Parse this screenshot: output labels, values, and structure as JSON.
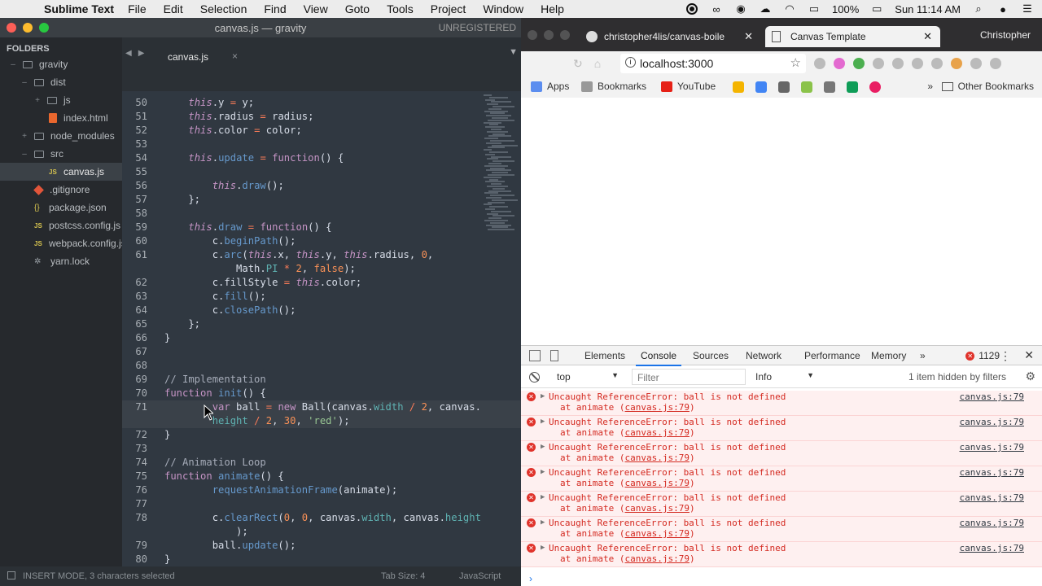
{
  "menubar": {
    "app_name": "Sublime Text",
    "items": [
      "File",
      "Edit",
      "Selection",
      "Find",
      "View",
      "Goto",
      "Tools",
      "Project",
      "Window",
      "Help"
    ],
    "battery": "100%",
    "clock": "Sun 11:14 AM"
  },
  "sublime": {
    "window_title": "canvas.js — gravity",
    "unregistered": "UNREGISTERED",
    "sidebar_header": "FOLDERS",
    "tree": [
      {
        "label": "gravity",
        "kind": "folder-open",
        "depth": 0
      },
      {
        "label": "dist",
        "kind": "folder-open",
        "depth": 1
      },
      {
        "label": "js",
        "kind": "folder-closed",
        "depth": 2
      },
      {
        "label": "index.html",
        "kind": "html",
        "depth": 2
      },
      {
        "label": "node_modules",
        "kind": "folder-closed",
        "depth": 1
      },
      {
        "label": "src",
        "kind": "folder-open",
        "depth": 1
      },
      {
        "label": "canvas.js",
        "kind": "js",
        "depth": 2,
        "selected": true
      },
      {
        "label": ".gitignore",
        "kind": "git",
        "depth": 1
      },
      {
        "label": "package.json",
        "kind": "json",
        "depth": 1
      },
      {
        "label": "postcss.config.js",
        "kind": "js",
        "depth": 1
      },
      {
        "label": "webpack.config.js",
        "kind": "js",
        "depth": 1
      },
      {
        "label": "yarn.lock",
        "kind": "dot",
        "depth": 1
      }
    ],
    "tab_label": "canvas.js",
    "status_mode": "INSERT MODE, 3 characters selected",
    "status_tabsize": "Tab Size: 4",
    "status_lang": "JavaScript",
    "code_lines": [
      {
        "n": "50",
        "html": "<span class=\"k\">this</span>.y <span class=\"op\">=</span> y;"
      },
      {
        "n": "51",
        "html": "<span class=\"k\">this</span>.radius <span class=\"op\">=</span> radius;"
      },
      {
        "n": "52",
        "html": "<span class=\"k\">this</span>.color <span class=\"op\">=</span> color;"
      },
      {
        "n": "53",
        "html": ""
      },
      {
        "n": "54",
        "html": "<span class=\"k\">this</span>.<span class=\"f\">update</span> <span class=\"op\">=</span> <span class=\"kw\">function</span>() {"
      },
      {
        "n": "55",
        "html": ""
      },
      {
        "n": "56",
        "html": "    <span class=\"k\">this</span>.<span class=\"f\">draw</span>();"
      },
      {
        "n": "57",
        "html": "};"
      },
      {
        "n": "58",
        "html": ""
      },
      {
        "n": "59",
        "html": "<span class=\"k\">this</span>.<span class=\"f\">draw</span> <span class=\"op\">=</span> <span class=\"kw\">function</span>() {"
      },
      {
        "n": "60",
        "html": "    c.<span class=\"f\">beginPath</span>();"
      },
      {
        "n": "61",
        "html": "    c.<span class=\"f\">arc</span>(<span class=\"k\">this</span>.x, <span class=\"k\">this</span>.y, <span class=\"k\">this</span>.radius, <span class=\"n\">0</span>,"
      },
      {
        "n": "",
        "html": "        Math.<span class=\"p\">PI</span> <span class=\"op\">*</span> <span class=\"n\">2</span>, <span class=\"n\">false</span>);"
      },
      {
        "n": "62",
        "html": "    c.fillStyle <span class=\"op\">=</span> <span class=\"k\">this</span>.color;"
      },
      {
        "n": "63",
        "html": "    c.<span class=\"f\">fill</span>();"
      },
      {
        "n": "64",
        "html": "    c.<span class=\"f\">closePath</span>();"
      },
      {
        "n": "65",
        "html": "};"
      },
      {
        "n": "66",
        "html": "}"
      },
      {
        "n": "67",
        "html": ""
      },
      {
        "n": "68",
        "html": ""
      },
      {
        "n": "69",
        "html": "<span class=\"cm\">// Implementation</span>"
      },
      {
        "n": "70",
        "html": "<span class=\"kw\">function</span> <span class=\"f\">init</span>() {"
      },
      {
        "n": "71",
        "html": "    <span class=\"kw\">var</span> ball <span class=\"op\">=</span> <span class=\"kw\">new</span> Ball(canvas.<span class=\"p\">width</span> <span class=\"op\">/</span> <span class=\"n\">2</span>, canvas."
      },
      {
        "n": "",
        "html": "    <span class=\"p\">height</span> <span class=\"op\">/</span> <span class=\"n\">2</span>, <span class=\"n\">30</span>, <span class=\"s\">'red'</span>);"
      },
      {
        "n": "72",
        "html": "}"
      },
      {
        "n": "73",
        "html": ""
      },
      {
        "n": "74",
        "html": "<span class=\"cm\">// Animation Loop</span>"
      },
      {
        "n": "75",
        "html": "<span class=\"kw\">function</span> <span class=\"f\">animate</span>() {"
      },
      {
        "n": "76",
        "html": "    <span class=\"f\">requestAnimationFrame</span>(animate);"
      },
      {
        "n": "77",
        "html": ""
      },
      {
        "n": "78",
        "html": "    c.<span class=\"f\">clearRect</span>(<span class=\"n\">0</span>, <span class=\"n\">0</span>, canvas.<span class=\"p\">width</span>, canvas.<span class=\"p\">height</span>"
      },
      {
        "n": "",
        "html": "        );"
      },
      {
        "n": "79",
        "html": "    ball.<span class=\"f\">update</span>();"
      },
      {
        "n": "80",
        "html": "}"
      }
    ]
  },
  "chrome": {
    "tab1_title": "christopher4lis/canvas-boile",
    "tab2_title": "Canvas Template",
    "profile": "Christopher",
    "url": "localhost:3000",
    "bookmarks": [
      "Apps",
      "Bookmarks",
      "YouTube"
    ],
    "other_bookmarks": "Other Bookmarks",
    "devtools": {
      "tabs": [
        "Elements",
        "Console",
        "Sources",
        "Network",
        "Performance",
        "Memory"
      ],
      "active_tab": "Console",
      "error_count": "1129",
      "context": "top",
      "filter_placeholder": "Filter",
      "level": "Info",
      "hidden_note": "1 item hidden by filters",
      "messages": [
        {
          "text": "Uncaught ReferenceError: ball is not defined",
          "at_prefix": "at animate (",
          "at_link": "canvas.js:79",
          "at_suffix": ")",
          "source": "canvas.js:79"
        },
        {
          "text": "Uncaught ReferenceError: ball is not defined",
          "at_prefix": "at animate (",
          "at_link": "canvas.js:79",
          "at_suffix": ")",
          "source": "canvas.js:79"
        },
        {
          "text": "Uncaught ReferenceError: ball is not defined",
          "at_prefix": "at animate (",
          "at_link": "canvas.js:79",
          "at_suffix": ")",
          "source": "canvas.js:79"
        },
        {
          "text": "Uncaught ReferenceError: ball is not defined",
          "at_prefix": "at animate (",
          "at_link": "canvas.js:79",
          "at_suffix": ")",
          "source": "canvas.js:79"
        },
        {
          "text": "Uncaught ReferenceError: ball is not defined",
          "at_prefix": "at animate (",
          "at_link": "canvas.js:79",
          "at_suffix": ")",
          "source": "canvas.js:79"
        },
        {
          "text": "Uncaught ReferenceError: ball is not defined",
          "at_prefix": "at animate (",
          "at_link": "canvas.js:79",
          "at_suffix": ")",
          "source": "canvas.js:79"
        },
        {
          "text": "Uncaught ReferenceError: ball is not defined",
          "at_prefix": "at animate (",
          "at_link": "canvas.js:79",
          "at_suffix": ")",
          "source": "canvas.js:79"
        }
      ]
    }
  }
}
